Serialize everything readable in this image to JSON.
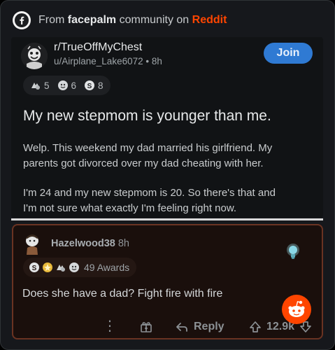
{
  "header": {
    "prefix": "From",
    "community": "facepalm",
    "middle": "community on",
    "platform": "Reddit"
  },
  "post": {
    "subreddit": "r/TrueOffMyChest",
    "author": "u/Airplane_Lake6072",
    "separator": "•",
    "age": "8h",
    "join_label": "Join",
    "awards": [
      {
        "icon": "helpful-award-icon",
        "count": "5"
      },
      {
        "icon": "wholesome-award-icon",
        "count": "6"
      },
      {
        "icon": "silver-award-icon",
        "count": "8"
      }
    ],
    "title": "My new stepmom is younger than me.",
    "body_line_1": "Welp. This weekend my dad married his girlfriend. My",
    "body_line_2": "parents got divorced over my dad cheating with her.",
    "body_line_3": "I'm 24 and my new stepmom is 20. So there's that and",
    "body_line_4": "I'm not sure what exactly I'm feeling right now."
  },
  "comment": {
    "username": "Hazelwood38",
    "age": "8h",
    "awards_text": "49 Awards",
    "text": "Does she have a dad?  Fight fire with fire",
    "reply_label": "Reply",
    "vote_count": "12.9k"
  },
  "colors": {
    "reddit_orange": "#ff4500",
    "join_blue": "#2f7ad3",
    "comment_border": "#6a3322"
  }
}
